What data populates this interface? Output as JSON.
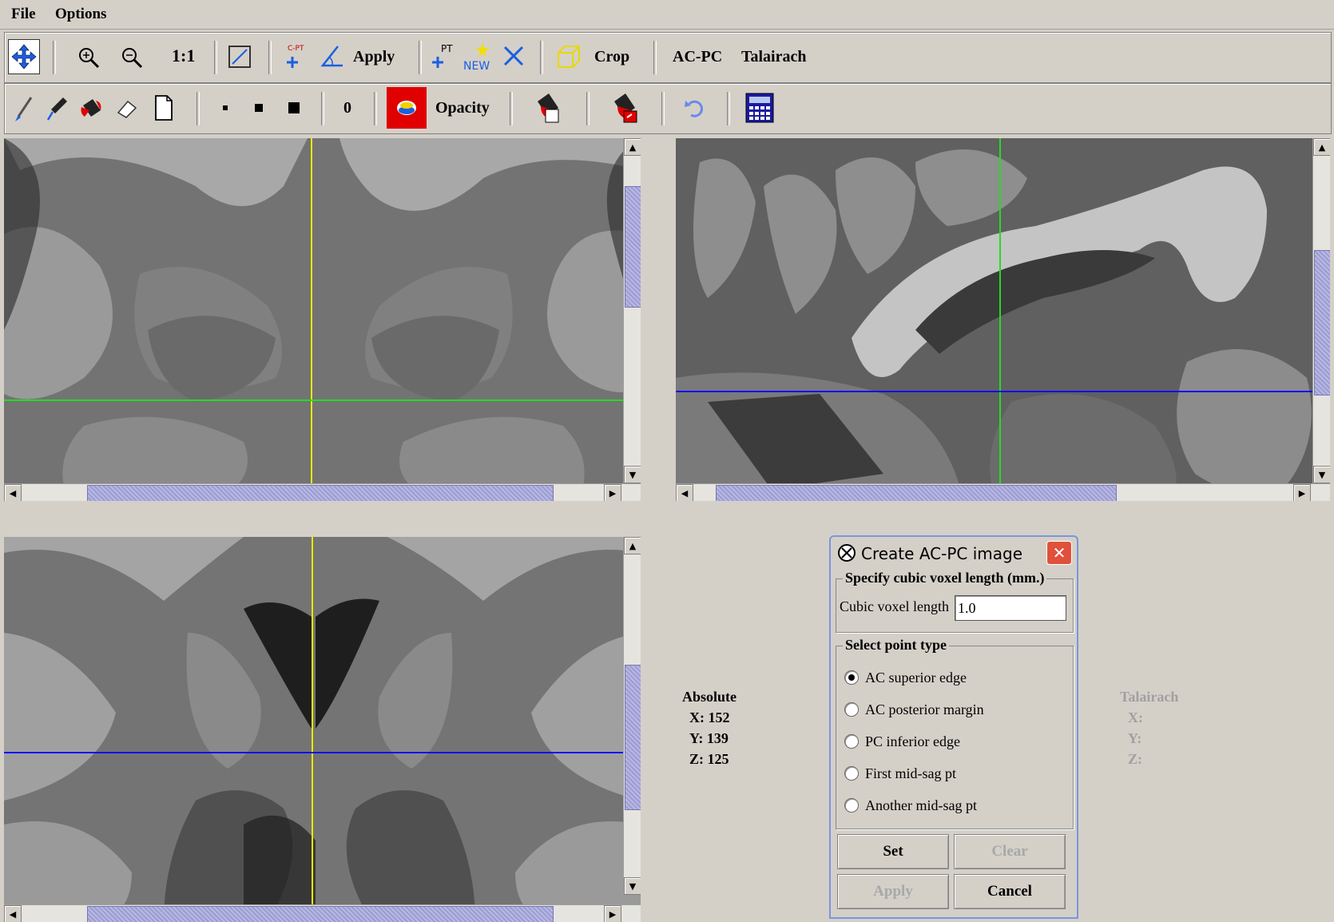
{
  "menu": {
    "items": [
      "File",
      "Options"
    ]
  },
  "toolbar1": {
    "one_to_one": "1:1",
    "cpt_badge": "C-PT",
    "apply_label": "Apply",
    "pt_badge": "PT",
    "new_badge": "NEW",
    "crop_label": "Crop",
    "acpc_label": "AC-PC",
    "talairach_label": "Talairach"
  },
  "toolbar2": {
    "value_label": "0",
    "opacity_label": "Opacity"
  },
  "absolute": {
    "title": "Absolute",
    "x": "X: 152",
    "y": "Y: 139",
    "z": "Z: 125"
  },
  "talairach": {
    "title": "Talairach",
    "x": "X:",
    "y": "Y:",
    "z": "Z:"
  },
  "dialog": {
    "title": "Create AC-PC image",
    "voxel_group": "Specify cubic voxel length (mm.)",
    "voxel_label": "Cubic voxel length",
    "voxel_value": "1.0",
    "point_group": "Select point type",
    "options": [
      "AC superior edge",
      "AC posterior margin",
      "PC inferior edge",
      "First mid-sag pt",
      "Another mid-sag pt"
    ],
    "selected_option": "AC superior edge",
    "set_label": "Set",
    "clear_label": "Clear",
    "apply_label": "Apply",
    "cancel_label": "Cancel"
  },
  "colors": {
    "yellow_crosshair": "#e8e800",
    "green_crosshair": "#22dd22",
    "blue_crosshair": "#1010ff",
    "scroll_thumb": "#aaaadd"
  }
}
